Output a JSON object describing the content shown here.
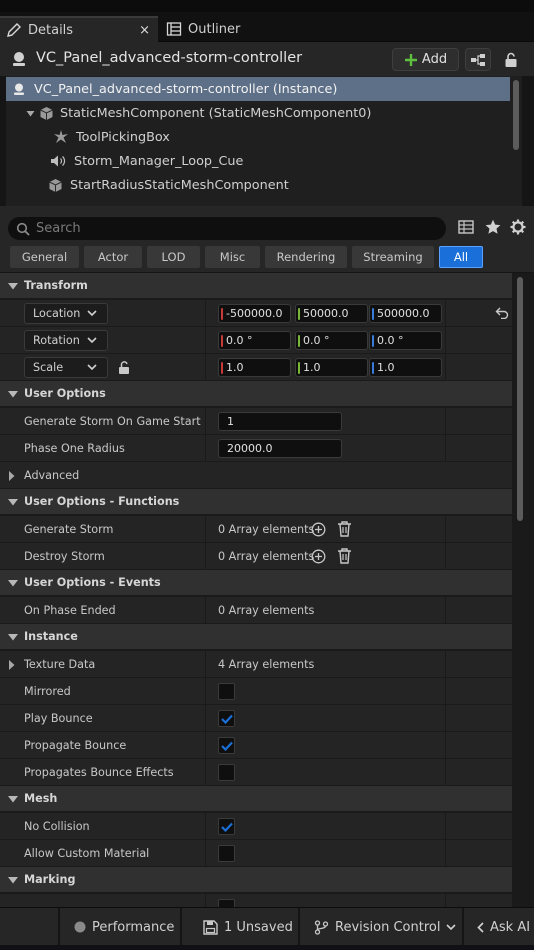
{
  "tabs": [
    {
      "label": "Details",
      "icon": "pencil-icon",
      "active": true
    },
    {
      "label": "Outliner",
      "icon": "outliner-icon",
      "active": false
    }
  ],
  "tab_close": "×",
  "header": {
    "title": "VC_Panel_advanced-storm-controller",
    "add_label": "Add"
  },
  "tree": {
    "items": [
      {
        "label": "VC_Panel_advanced-storm-controller (Instance)",
        "icon": "actor-icon"
      },
      {
        "label": "StaticMeshComponent (StaticMeshComponent0)",
        "icon": "static-mesh-icon"
      },
      {
        "label": "ToolPickingBox",
        "icon": "sprite-icon"
      },
      {
        "label": "Storm_Manager_Loop_Cue",
        "icon": "audio-icon"
      },
      {
        "label": "StartRadiusStaticMeshComponent",
        "icon": "static-mesh-icon"
      }
    ]
  },
  "search": {
    "placeholder": "Search"
  },
  "filters": [
    "General",
    "Actor",
    "LOD",
    "Misc",
    "Rendering",
    "Streaming",
    "All"
  ],
  "sections": {
    "transform": "Transform",
    "user_options": "User Options",
    "advanced": "Advanced",
    "user_options_functions": "User Options - Functions",
    "user_options_events": "User Options - Events",
    "instance": "Instance",
    "mesh": "Mesh",
    "marking": "Marking"
  },
  "transform": {
    "location": {
      "label": "Location",
      "x": "-500000.0",
      "y": "50000.0",
      "z": "500000.0"
    },
    "rotation": {
      "label": "Rotation",
      "x": "0.0 °",
      "y": "0.0 °",
      "z": "0.0 °"
    },
    "scale": {
      "label": "Scale",
      "x": "1.0",
      "y": "1.0",
      "z": "1.0"
    }
  },
  "user_options": {
    "generate_storm_label": "Generate Storm On Game Start",
    "generate_storm_value": "1",
    "phase_one_label": "Phase One Radius",
    "phase_one_value": "20000.0"
  },
  "functions": {
    "generate_storm_label": "Generate Storm",
    "generate_storm_value": "0 Array elements",
    "destroy_storm_label": "Destroy Storm",
    "destroy_storm_value": "0 Array elements"
  },
  "events": {
    "on_phase_ended_label": "On Phase Ended",
    "on_phase_ended_value": "0 Array elements"
  },
  "instance": {
    "texture_data_label": "Texture Data",
    "texture_data_value": "4 Array elements",
    "mirrored_label": "Mirrored",
    "mirrored": false,
    "play_bounce_label": "Play Bounce",
    "play_bounce": true,
    "propagate_bounce_label": "Propagate Bounce",
    "propagate_bounce": true,
    "propagates_bounce_effects_label": "Propagates Bounce Effects",
    "propagates_bounce_effects": false
  },
  "mesh": {
    "no_collision_label": "No Collision",
    "no_collision": true,
    "allow_custom_material_label": "Allow Custom Material",
    "allow_custom_material": false
  },
  "status": {
    "performance": "Performance",
    "unsaved": "1 Unsaved",
    "revision": "Revision Control",
    "ask_ai": "Ask AI"
  },
  "colors": {
    "accent": "#1a6fd8",
    "x_axis": "#c83a3a",
    "y_axis": "#7ab83a",
    "z_axis": "#3a7ad8",
    "add_plus": "#5fbf3f"
  }
}
